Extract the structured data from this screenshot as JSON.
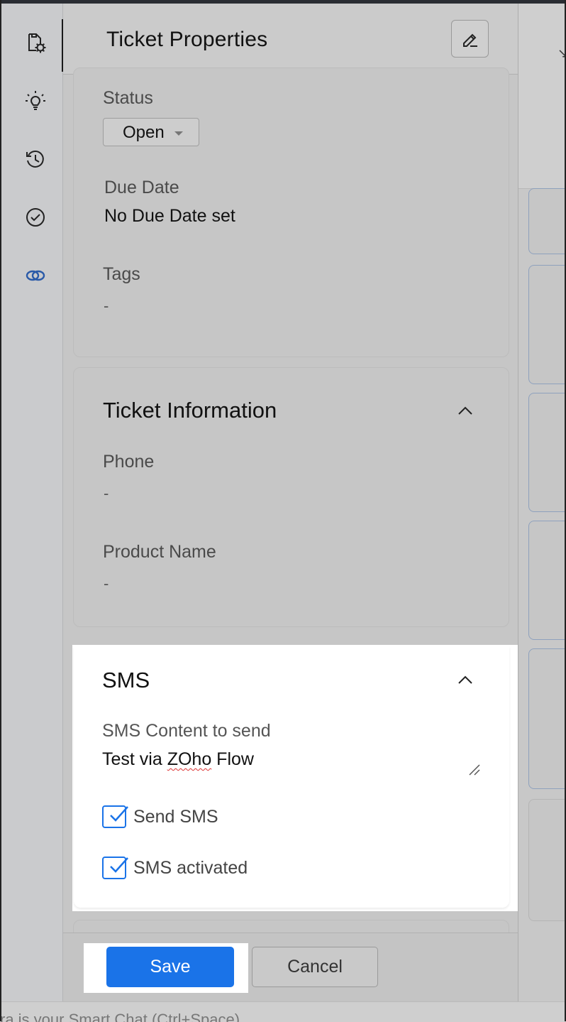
{
  "header": {
    "title": "Ticket Properties"
  },
  "rail": {
    "icons": [
      "ticket-settings-icon",
      "lightbulb-icon",
      "history-icon",
      "check-circle-icon",
      "link-icon"
    ]
  },
  "properties": {
    "status_label": "Status",
    "status_value": "Open",
    "due_date_label": "Due Date",
    "due_date_value": "No Due Date set",
    "tags_label": "Tags",
    "tags_value": "-"
  },
  "ticket_information": {
    "title": "Ticket Information",
    "phone_label": "Phone",
    "phone_value": "-",
    "product_label": "Product Name",
    "product_value": "-"
  },
  "sms": {
    "title": "SMS",
    "content_label": "SMS Content to send",
    "content_prefix": "Test via ",
    "content_misspelled": "ZOho",
    "content_suffix": " Flow",
    "checkboxes": [
      {
        "label": "Send SMS",
        "checked": true
      },
      {
        "label": "SMS activated",
        "checked": true
      }
    ]
  },
  "footer": {
    "save_label": "Save",
    "cancel_label": "Cancel"
  },
  "statusbar": {
    "text": "ra is your Smart Chat (Ctrl+Space)"
  },
  "colors": {
    "accent": "#1a73e8",
    "panel_bg": "#c6c6c6",
    "highlight": "#ffffff"
  }
}
